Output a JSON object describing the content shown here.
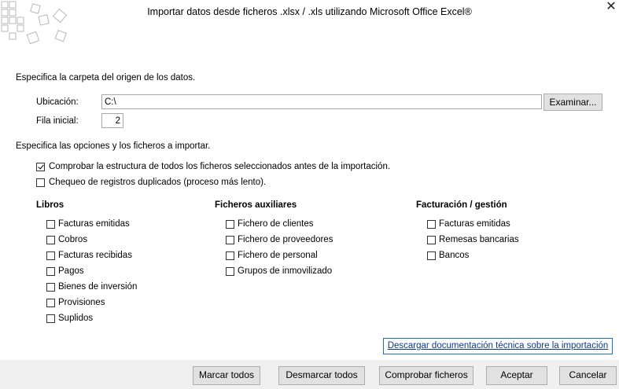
{
  "dialog": {
    "title": "Importar datos desde ficheros .xlsx / .xls utilizando Microsoft Office Excel®",
    "close_icon": "close-icon"
  },
  "source": {
    "heading": "Especifica la carpeta del origen de los datos.",
    "location_label": "Ubicación:",
    "location_value": "C:\\",
    "browse_label": "Examinar...",
    "start_row_label": "Fila inicial:",
    "start_row_value": "2"
  },
  "options": {
    "heading": "Especifica las opciones y los ficheros a importar.",
    "check_structure": {
      "label": "Comprobar la estructura de todos los ficheros seleccionados antes de la importación.",
      "checked": true
    },
    "check_duplicates": {
      "label": "Chequeo de registros duplicados (proceso más lento).",
      "checked": false
    }
  },
  "groups": [
    {
      "title": "Libros",
      "items": [
        {
          "label": "Facturas emitidas",
          "checked": false
        },
        {
          "label": "Cobros",
          "checked": false
        },
        {
          "label": "Facturas recibidas",
          "checked": false
        },
        {
          "label": "Pagos",
          "checked": false
        },
        {
          "label": "Bienes de inversión",
          "checked": false
        },
        {
          "label": "Provisiones",
          "checked": false
        },
        {
          "label": "Suplidos",
          "checked": false
        }
      ]
    },
    {
      "title": "Ficheros auxiliares",
      "items": [
        {
          "label": "Fichero de clientes",
          "checked": false
        },
        {
          "label": "Fichero de proveedores",
          "checked": false
        },
        {
          "label": "Fichero de personal",
          "checked": false
        },
        {
          "label": "Grupos de inmovilizado",
          "checked": false
        }
      ]
    },
    {
      "title": "Facturación / gestión",
      "items": [
        {
          "label": "Facturas emitidas",
          "checked": false
        },
        {
          "label": "Remesas bancarias",
          "checked": false
        },
        {
          "label": "Bancos",
          "checked": false
        }
      ]
    }
  ],
  "link": {
    "label": "Descargar documentación técnica sobre la importación"
  },
  "footer": {
    "mark_all": "Marcar todos",
    "unmark_all": "Desmarcar todos",
    "check_files": "Comprobar ficheros",
    "accept": "Aceptar",
    "cancel": "Cancelar"
  },
  "colors": {
    "link_border": "#1e6fbf",
    "footer_bg": "#f0f0f0"
  }
}
